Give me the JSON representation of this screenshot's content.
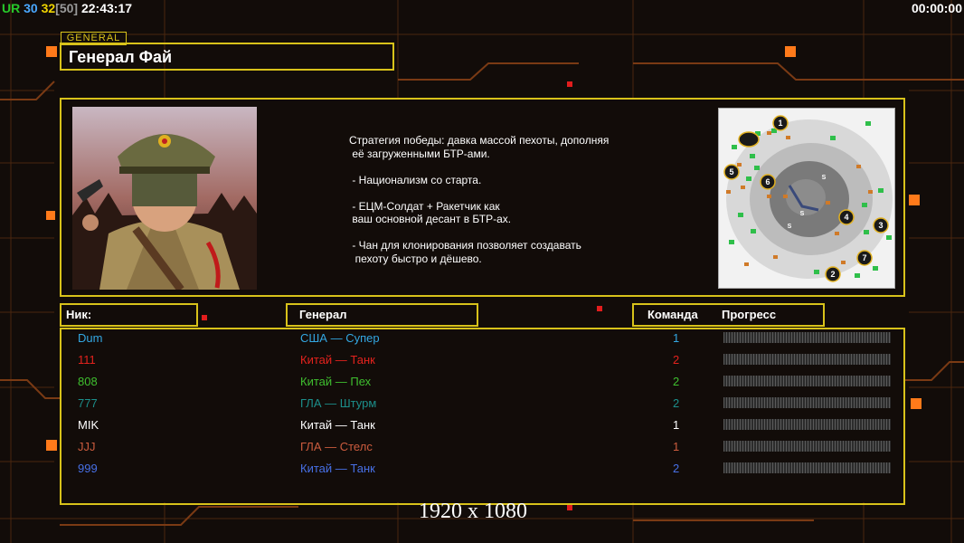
{
  "hud": {
    "tag": "UR",
    "val1": "30",
    "val2": "32",
    "val3": "[50]",
    "clock": "22:43:17",
    "timer": "00:00:00"
  },
  "general": {
    "tag": "GENERAL",
    "name": "Генерал Фай",
    "description": "Стратегия победы: давка массой пехоты, дополняя\n её загруженными БТР-ами.\n\n - Национализм со старта.\n\n - ЕЦМ-Солдат + Ракетчик как\n ваш основной десант в БТР-ах.\n\n - Чан для клонирования позволяет создавать\n  пехоту быстро и дёшево."
  },
  "table": {
    "headers": {
      "nick": "Ник:",
      "general": "Генерал",
      "team": "Команда",
      "progress": "Прогресс"
    },
    "rows": [
      {
        "nick": "Dum",
        "general": "США — Супер",
        "team": "1",
        "color": "#33a7e2",
        "progress": 0
      },
      {
        "nick": "111",
        "general": "Китай — Танк",
        "team": "2",
        "color": "#e4221d",
        "progress": 0
      },
      {
        "nick": "808",
        "general": "Китай — Пех",
        "team": "2",
        "color": "#3fbf2f",
        "progress": 0
      },
      {
        "nick": "777",
        "general": "ГЛА — Штурм",
        "team": "2",
        "color": "#1c8f8b",
        "progress": 0
      },
      {
        "nick": "MIK",
        "general": "Китай — Танк",
        "team": "1",
        "color": "#ffffff",
        "progress": 0
      },
      {
        "nick": "JJJ",
        "general": "ГЛА — Стелс",
        "team": "1",
        "color": "#cc5c3e",
        "progress": 0
      },
      {
        "nick": "999",
        "general": "Китай — Танк",
        "team": "2",
        "color": "#4770e6",
        "progress": 0
      }
    ]
  },
  "minimap": {
    "start_positions": [
      "1",
      "2",
      "3",
      "4",
      "5",
      "6",
      "7"
    ]
  },
  "resolution": "1920 x 1080",
  "colors": {
    "accent": "#d8c21a",
    "background": "#120c09",
    "grid_line": "#5a2a10",
    "glow": "#ff7a1a"
  }
}
